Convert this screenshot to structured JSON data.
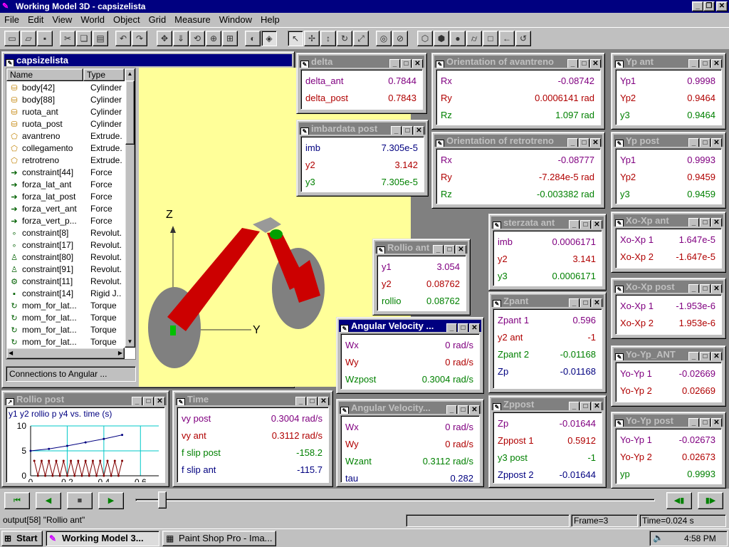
{
  "app": {
    "title": "Working Model 3D - capsizelista"
  },
  "menu": [
    "File",
    "Edit",
    "View",
    "World",
    "Object",
    "Grid",
    "Measure",
    "Window",
    "Help"
  ],
  "browser": {
    "title": "capsizelista",
    "col_name": "Name",
    "col_type": "Type",
    "items": [
      {
        "name": "body[42]",
        "type": "Cylinder",
        "icon": "cylinder-icon"
      },
      {
        "name": "body[88]",
        "type": "Cylinder",
        "icon": "cylinder-icon"
      },
      {
        "name": "ruota_ant",
        "type": "Cylinder",
        "icon": "cylinder-icon"
      },
      {
        "name": "ruota_post",
        "type": "Cylinder",
        "icon": "cylinder-icon"
      },
      {
        "name": "avantreno",
        "type": "Extrude.",
        "icon": "extrusion-icon"
      },
      {
        "name": "collegamento",
        "type": "Extrude.",
        "icon": "extrusion-icon"
      },
      {
        "name": "retrotreno",
        "type": "Extrude.",
        "icon": "extrusion-icon"
      },
      {
        "name": "constraint[44]",
        "type": "Force",
        "icon": "force-arrow-icon"
      },
      {
        "name": "forza_lat_ant",
        "type": "Force",
        "icon": "force-arrow-icon"
      },
      {
        "name": "forza_lat_post",
        "type": "Force",
        "icon": "force-arrow-icon"
      },
      {
        "name": "forza_vert_ant",
        "type": "Force",
        "icon": "force-arrow-icon"
      },
      {
        "name": "forza_vert_p...",
        "type": "Force",
        "icon": "force-arrow-icon"
      },
      {
        "name": "constraint[8]",
        "type": "Revolut.",
        "icon": "revolute-joint-icon"
      },
      {
        "name": "constraint[17]",
        "type": "Revolut.",
        "icon": "revolute-joint-icon"
      },
      {
        "name": "constraint[80]",
        "type": "Revolut.",
        "icon": "revolute-motor-icon"
      },
      {
        "name": "constraint[91]",
        "type": "Revolut.",
        "icon": "revolute-motor-icon"
      },
      {
        "name": "constraint[11]",
        "type": "Revolut.",
        "icon": "revolute-spring-icon"
      },
      {
        "name": "constraint[14]",
        "type": "Rigid J..",
        "icon": "rigid-joint-icon"
      },
      {
        "name": "mom_for_lat...",
        "type": "Torque",
        "icon": "torque-icon"
      },
      {
        "name": "mom_for_lat...",
        "type": "Torque",
        "icon": "torque-icon"
      },
      {
        "name": "mom_for_lat...",
        "type": "Torque",
        "icon": "torque-icon"
      },
      {
        "name": "mom_for_lat...",
        "type": "Torque",
        "icon": "torque-icon"
      }
    ],
    "connections": "Connections to Angular ..."
  },
  "axes": {
    "z": "Z",
    "y": "Y"
  },
  "meters": {
    "delta": {
      "title": "delta",
      "rows": [
        {
          "l": "delta_ant",
          "v": "0.7844"
        },
        {
          "l": "delta_post",
          "v": "0.7843"
        }
      ]
    },
    "imbardata": {
      "title": "imbardata post",
      "rows": [
        {
          "l": "imb",
          "v": "7.305e-5"
        },
        {
          "l": "y2",
          "v": "3.142"
        },
        {
          "l": "y3",
          "v": "7.305e-5"
        }
      ]
    },
    "orient_ant": {
      "title": "Orientation of avantreno",
      "rows": [
        {
          "l": "Rx",
          "v": "-0.08742"
        },
        {
          "l": "Ry",
          "v": "0.0006141 rad"
        },
        {
          "l": "Rz",
          "v": "1.097 rad"
        }
      ]
    },
    "orient_retro": {
      "title": "Orientation of retrotreno",
      "rows": [
        {
          "l": "Rx",
          "v": "-0.08777"
        },
        {
          "l": "Ry",
          "v": "-7.284e-5 rad"
        },
        {
          "l": "Rz",
          "v": "-0.003382 rad"
        }
      ]
    },
    "yp_ant": {
      "title": "Yp ant",
      "rows": [
        {
          "l": "Yp1",
          "v": "0.9998"
        },
        {
          "l": "Yp2",
          "v": "0.9464"
        },
        {
          "l": "y3",
          "v": "0.9464"
        }
      ]
    },
    "yp_post": {
      "title": "Yp post",
      "rows": [
        {
          "l": "Yp1",
          "v": "0.9993"
        },
        {
          "l": "Yp2",
          "v": "0.9459"
        },
        {
          "l": "y3",
          "v": "0.9459"
        }
      ]
    },
    "sterzata": {
      "title": "sterzata ant",
      "rows": [
        {
          "l": "imb",
          "v": "0.0006171"
        },
        {
          "l": "y2",
          "v": "3.141"
        },
        {
          "l": "y3",
          "v": "0.0006171"
        }
      ]
    },
    "rollio_ant": {
      "title": "Rollio ant",
      "rows": [
        {
          "l": "y1",
          "v": "3.054"
        },
        {
          "l": "y2",
          "v": "0.08762"
        },
        {
          "l": "rollio",
          "v": "0.08762"
        }
      ]
    },
    "xo_ant": {
      "title": "Xo-Xp ant",
      "rows": [
        {
          "l": "Xo-Xp 1",
          "v": "1.647e-5"
        },
        {
          "l": "Xo-Xp 2",
          "v": "-1.647e-5"
        }
      ]
    },
    "xo_post": {
      "title": "Xo-Xp post",
      "rows": [
        {
          "l": "Xo-Xp 1",
          "v": "-1.953e-6"
        },
        {
          "l": "Xo-Xp 2",
          "v": "1.953e-6"
        }
      ]
    },
    "angvel1": {
      "title": "Angular Velocity ...",
      "rows": [
        {
          "l": "Wx",
          "v": "0 rad/s"
        },
        {
          "l": "Wy",
          "v": "0 rad/s"
        },
        {
          "l": "Wzpost",
          "v": "0.3004 rad/s"
        }
      ]
    },
    "zpant": {
      "title": "Zpant",
      "rows": [
        {
          "l": "Zpant 1",
          "v": "0.596"
        },
        {
          "l": "y2 ant",
          "v": "-1"
        },
        {
          "l": "Zpant 2",
          "v": "-0.01168"
        },
        {
          "l": "Zp",
          "v": "-0.01168"
        }
      ]
    },
    "yo_ant": {
      "title": "Yo-Yp_ANT",
      "rows": [
        {
          "l": "Yo-Yp 1",
          "v": "-0.02669"
        },
        {
          "l": "Yo-Yp 2",
          "v": "0.02669"
        }
      ]
    },
    "time": {
      "title": "Time",
      "rows": [
        {
          "l": "vy post",
          "v": "0.3004 rad/s"
        },
        {
          "l": "vy ant",
          "v": "0.3112 rad/s"
        },
        {
          "l": "f slip post",
          "v": "-158.2"
        },
        {
          "l": "f slip ant",
          "v": "-115.7"
        }
      ]
    },
    "angvel2": {
      "title": "Angular Velocity...",
      "rows": [
        {
          "l": "Wx",
          "v": "0 rad/s"
        },
        {
          "l": "Wy",
          "v": "0 rad/s"
        },
        {
          "l": "Wzant",
          "v": "0.3112 rad/s"
        },
        {
          "l": "tau",
          "v": "0.282"
        }
      ]
    },
    "zppost": {
      "title": "Zppost",
      "rows": [
        {
          "l": "Zp",
          "v": "-0.01644"
        },
        {
          "l": "Zppost 1",
          "v": "0.5912"
        },
        {
          "l": "y3 post",
          "v": "-1"
        },
        {
          "l": "Zppost 2",
          "v": "-0.01644"
        }
      ]
    },
    "yo_post": {
      "title": "Yo-Yp post",
      "rows": [
        {
          "l": "Yo-Yp 1",
          "v": "-0.02673"
        },
        {
          "l": "Yo-Yp 2",
          "v": "0.02673"
        },
        {
          "l": "yp",
          "v": "0.9993"
        }
      ]
    }
  },
  "rollio_post": {
    "title": "Rollio post",
    "legend": "y1 y2 rollio p y4 vs. time (s)"
  },
  "chart_data": {
    "type": "line",
    "xlabel": "",
    "ylabel": "",
    "xlim": [
      0,
      0.7
    ],
    "ylim": [
      0,
      10
    ],
    "xticks": [
      "0",
      "0.2",
      "0.4",
      "0.6"
    ],
    "yticks": [
      "0",
      "5",
      "10"
    ],
    "series": [
      {
        "name": "y1",
        "color": "#000080",
        "x": [
          0,
          0.1,
          0.2,
          0.3,
          0.4,
          0.5
        ],
        "values": [
          5,
          5.4,
          6,
          6.7,
          7.4,
          8.2
        ]
      },
      {
        "name": "rollio p",
        "color": "#800000",
        "x": [
          0.02,
          0.04,
          0.06,
          0.08,
          0.1,
          0.12,
          0.14,
          0.16,
          0.18,
          0.2,
          0.22,
          0.24,
          0.26,
          0.28,
          0.3,
          0.32,
          0.34,
          0.36,
          0.38,
          0.4,
          0.42,
          0.44,
          0.46,
          0.48,
          0.5
        ],
        "values": [
          3,
          0,
          3,
          0,
          3,
          0,
          3,
          0,
          3,
          0,
          3,
          0,
          3,
          0,
          3,
          0,
          3,
          0,
          3,
          0,
          3,
          0,
          3,
          0,
          3
        ]
      }
    ]
  },
  "status": {
    "left": "output[58] \"Rollio ant\"",
    "frame": "Frame=3",
    "time": "Time=0.024 s"
  },
  "taskbar": {
    "start": "Start",
    "task1": "Working Model 3...",
    "task2": "Paint Shop Pro - Ima...",
    "clock": "4:58 PM"
  }
}
